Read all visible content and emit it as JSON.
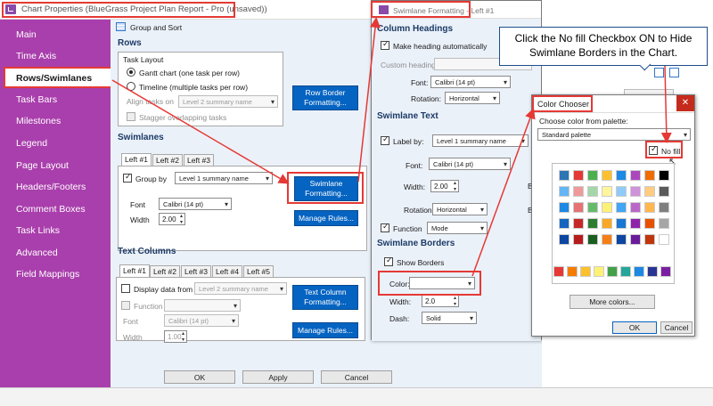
{
  "main_window": {
    "title": "Chart Properties (BlueGrass Project Plan Report - Pro (unsaved))"
  },
  "sidebar": {
    "items": [
      {
        "label": "Main"
      },
      {
        "label": "Time Axis"
      },
      {
        "label": "Rows/Swimlanes"
      },
      {
        "label": "Task Bars"
      },
      {
        "label": "Milestones"
      },
      {
        "label": "Legend"
      },
      {
        "label": "Page Layout"
      },
      {
        "label": "Headers/Footers"
      },
      {
        "label": "Comment Boxes"
      },
      {
        "label": "Task Links"
      },
      {
        "label": "Advanced"
      },
      {
        "label": "Field Mappings"
      }
    ],
    "active": "Rows/Swimlanes"
  },
  "toolbar": {
    "group_sort": "Group and Sort"
  },
  "rows": {
    "heading": "Rows",
    "task_layout": "Task Layout",
    "gantt": "Gantt chart (one task per row)",
    "timeline": "Timeline (multiple tasks per row)",
    "align_label": "Align tasks on",
    "align_value": "Level 2 summary name",
    "stagger": "Stagger overlapping tasks",
    "border_btn_1": "Row Border",
    "border_btn_2": "Formatting..."
  },
  "swimlanes": {
    "heading": "Swimlanes",
    "tabs": [
      "Left #1",
      "Left #2",
      "Left #3"
    ],
    "group_by": "Group by",
    "group_value": "Level 1 summary name",
    "font_label": "Font",
    "font_value": "Calibri (14 pt)",
    "width_label": "Width",
    "width_value": "2.00",
    "fmt_btn_1": "Swimlane",
    "fmt_btn_2": "Formatting...",
    "rules_btn": "Manage Rules..."
  },
  "text_columns": {
    "heading": "Text Columns",
    "tabs": [
      "Left #1",
      "Left #2",
      "Left #3",
      "Left #4",
      "Left #5"
    ],
    "display_from": "Display data from",
    "display_value": "Level 2 summary name",
    "function_label": "Function",
    "font_label": "Font",
    "font_value": "Calibri (14 pt)",
    "width_label": "Width",
    "width_value": "1.00",
    "fmt_btn_1": "Text Column",
    "fmt_btn_2": "Formatting...",
    "rules_btn": "Manage Rules..."
  },
  "bottom": {
    "ok": "OK",
    "apply": "Apply",
    "cancel": "Cancel"
  },
  "swimlane_dialog": {
    "title": "Swimlane Formatting - Left #1",
    "col_headings": "Column Headings",
    "make_auto": "Make heading automatically",
    "custom_label": "Custom heading:",
    "font_label": "Font:",
    "font_value": "Calibri (14 pt)",
    "rotation_label": "Rotation:",
    "rotation_value": "Horizontal",
    "swim_text": "Swimlane Text",
    "label_by": "Label by:",
    "label_value": "Level 1 summary name",
    "font2_label": "Font:",
    "font2_value": "Calibri (14 pt)",
    "width_label": "Width:",
    "width_value": "2.00",
    "rotation2_label": "Rotation:",
    "rotation2_value": "Horizontal",
    "function_label": "Function",
    "function_value": "Mode",
    "borders": "Swimlane Borders",
    "show_borders": "Show Borders",
    "color_label": "Color:",
    "bwidth_label": "Width:",
    "bwidth_value": "2.0",
    "dash_label": "Dash:",
    "dash_value": "Solid",
    "b_fragment": "B"
  },
  "color_dialog": {
    "title": "Color Chooser",
    "palette_label": "Choose color from palette:",
    "palette_value": "Standard palette",
    "no_fill": "No fill",
    "more": "More colors...",
    "ok": "OK",
    "cancel": "Cancel",
    "swatch_rows": [
      [
        "#2e75b6",
        "#e53935",
        "#4caf50",
        "#fbc02d",
        "#1e88e5",
        "#ab47bc",
        "#ef6c00",
        "#000000"
      ],
      [
        "#64b5f6",
        "#ef9a9a",
        "#a5d6a7",
        "#fff59d",
        "#90caf9",
        "#ce93d8",
        "#ffcc80",
        "#595959"
      ],
      [
        "#1e88e5",
        "#e57373",
        "#66bb6a",
        "#fff176",
        "#42a5f5",
        "#ba68c8",
        "#ffb74d",
        "#7f7f7f"
      ],
      [
        "#1565c0",
        "#c62828",
        "#2e7d32",
        "#f9a825",
        "#1976d2",
        "#8e24aa",
        "#e65100",
        "#a6a6a6"
      ],
      [
        "#0d47a1",
        "#b71c1c",
        "#1b5e20",
        "#f57f17",
        "#0d47a1",
        "#6a1b9a",
        "#bf360c",
        "#ffffff"
      ]
    ],
    "bottom_row": [
      "#e53935",
      "#f57c00",
      "#fbc02d",
      "#fff176",
      "#43a047",
      "#26a69a",
      "#1e88e5",
      "#283593",
      "#7b1fa2"
    ]
  },
  "callout": {
    "text": "Click the No fill Checkbox ON to Hide Swimlane Borders in the Chart."
  }
}
